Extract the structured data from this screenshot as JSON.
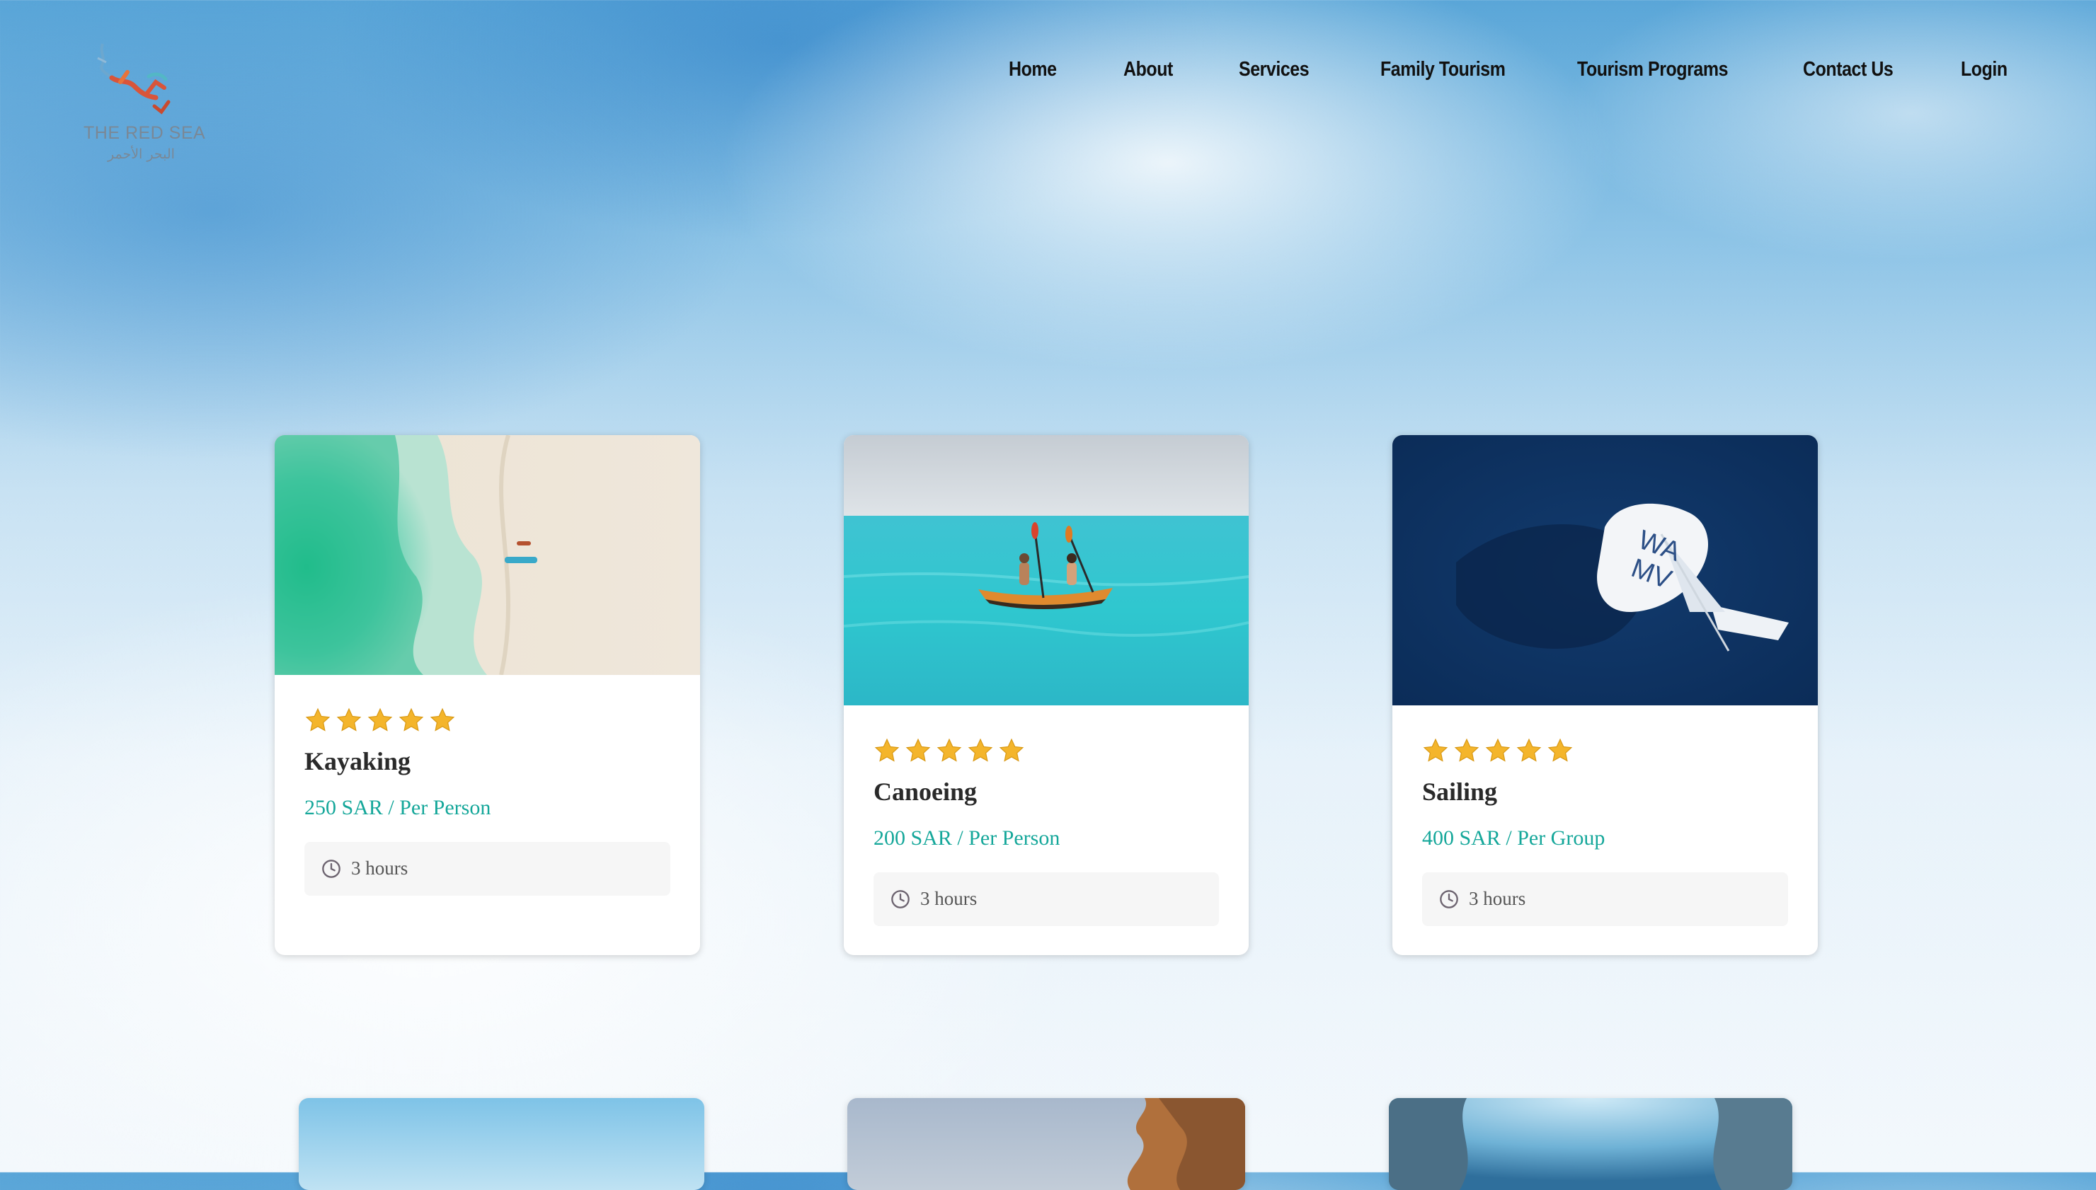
{
  "brand": {
    "name_en": "THE RED SEA",
    "name_ar": "البحر الأحمر",
    "logo_icon": "red-sea-coral-logo"
  },
  "nav": [
    {
      "label": "Home"
    },
    {
      "label": "About"
    },
    {
      "label": "Services"
    },
    {
      "label": "Family Tourism"
    },
    {
      "label": "Tourism Programs"
    },
    {
      "label": "Contact Us"
    },
    {
      "label": "Login"
    }
  ],
  "cards": [
    {
      "title": "Kayaking",
      "price": "250 SAR / Per Person",
      "duration": "3 hours",
      "rating": 5,
      "image": "aerial-beach-kayak-photo"
    },
    {
      "title": "Canoeing",
      "price": "200 SAR / Per Person",
      "duration": "3 hours",
      "rating": 5,
      "image": "sea-canoe-photo"
    },
    {
      "title": "Sailing",
      "price": "400 SAR / Per Group",
      "duration": "3 hours",
      "rating": 5,
      "image": "aerial-sailboat-photo"
    }
  ],
  "colors": {
    "price": "#15a79a",
    "star": "#f4b52b",
    "title": "#2a2a2a"
  },
  "icons": {
    "star": "star-icon",
    "clock": "clock-icon"
  }
}
